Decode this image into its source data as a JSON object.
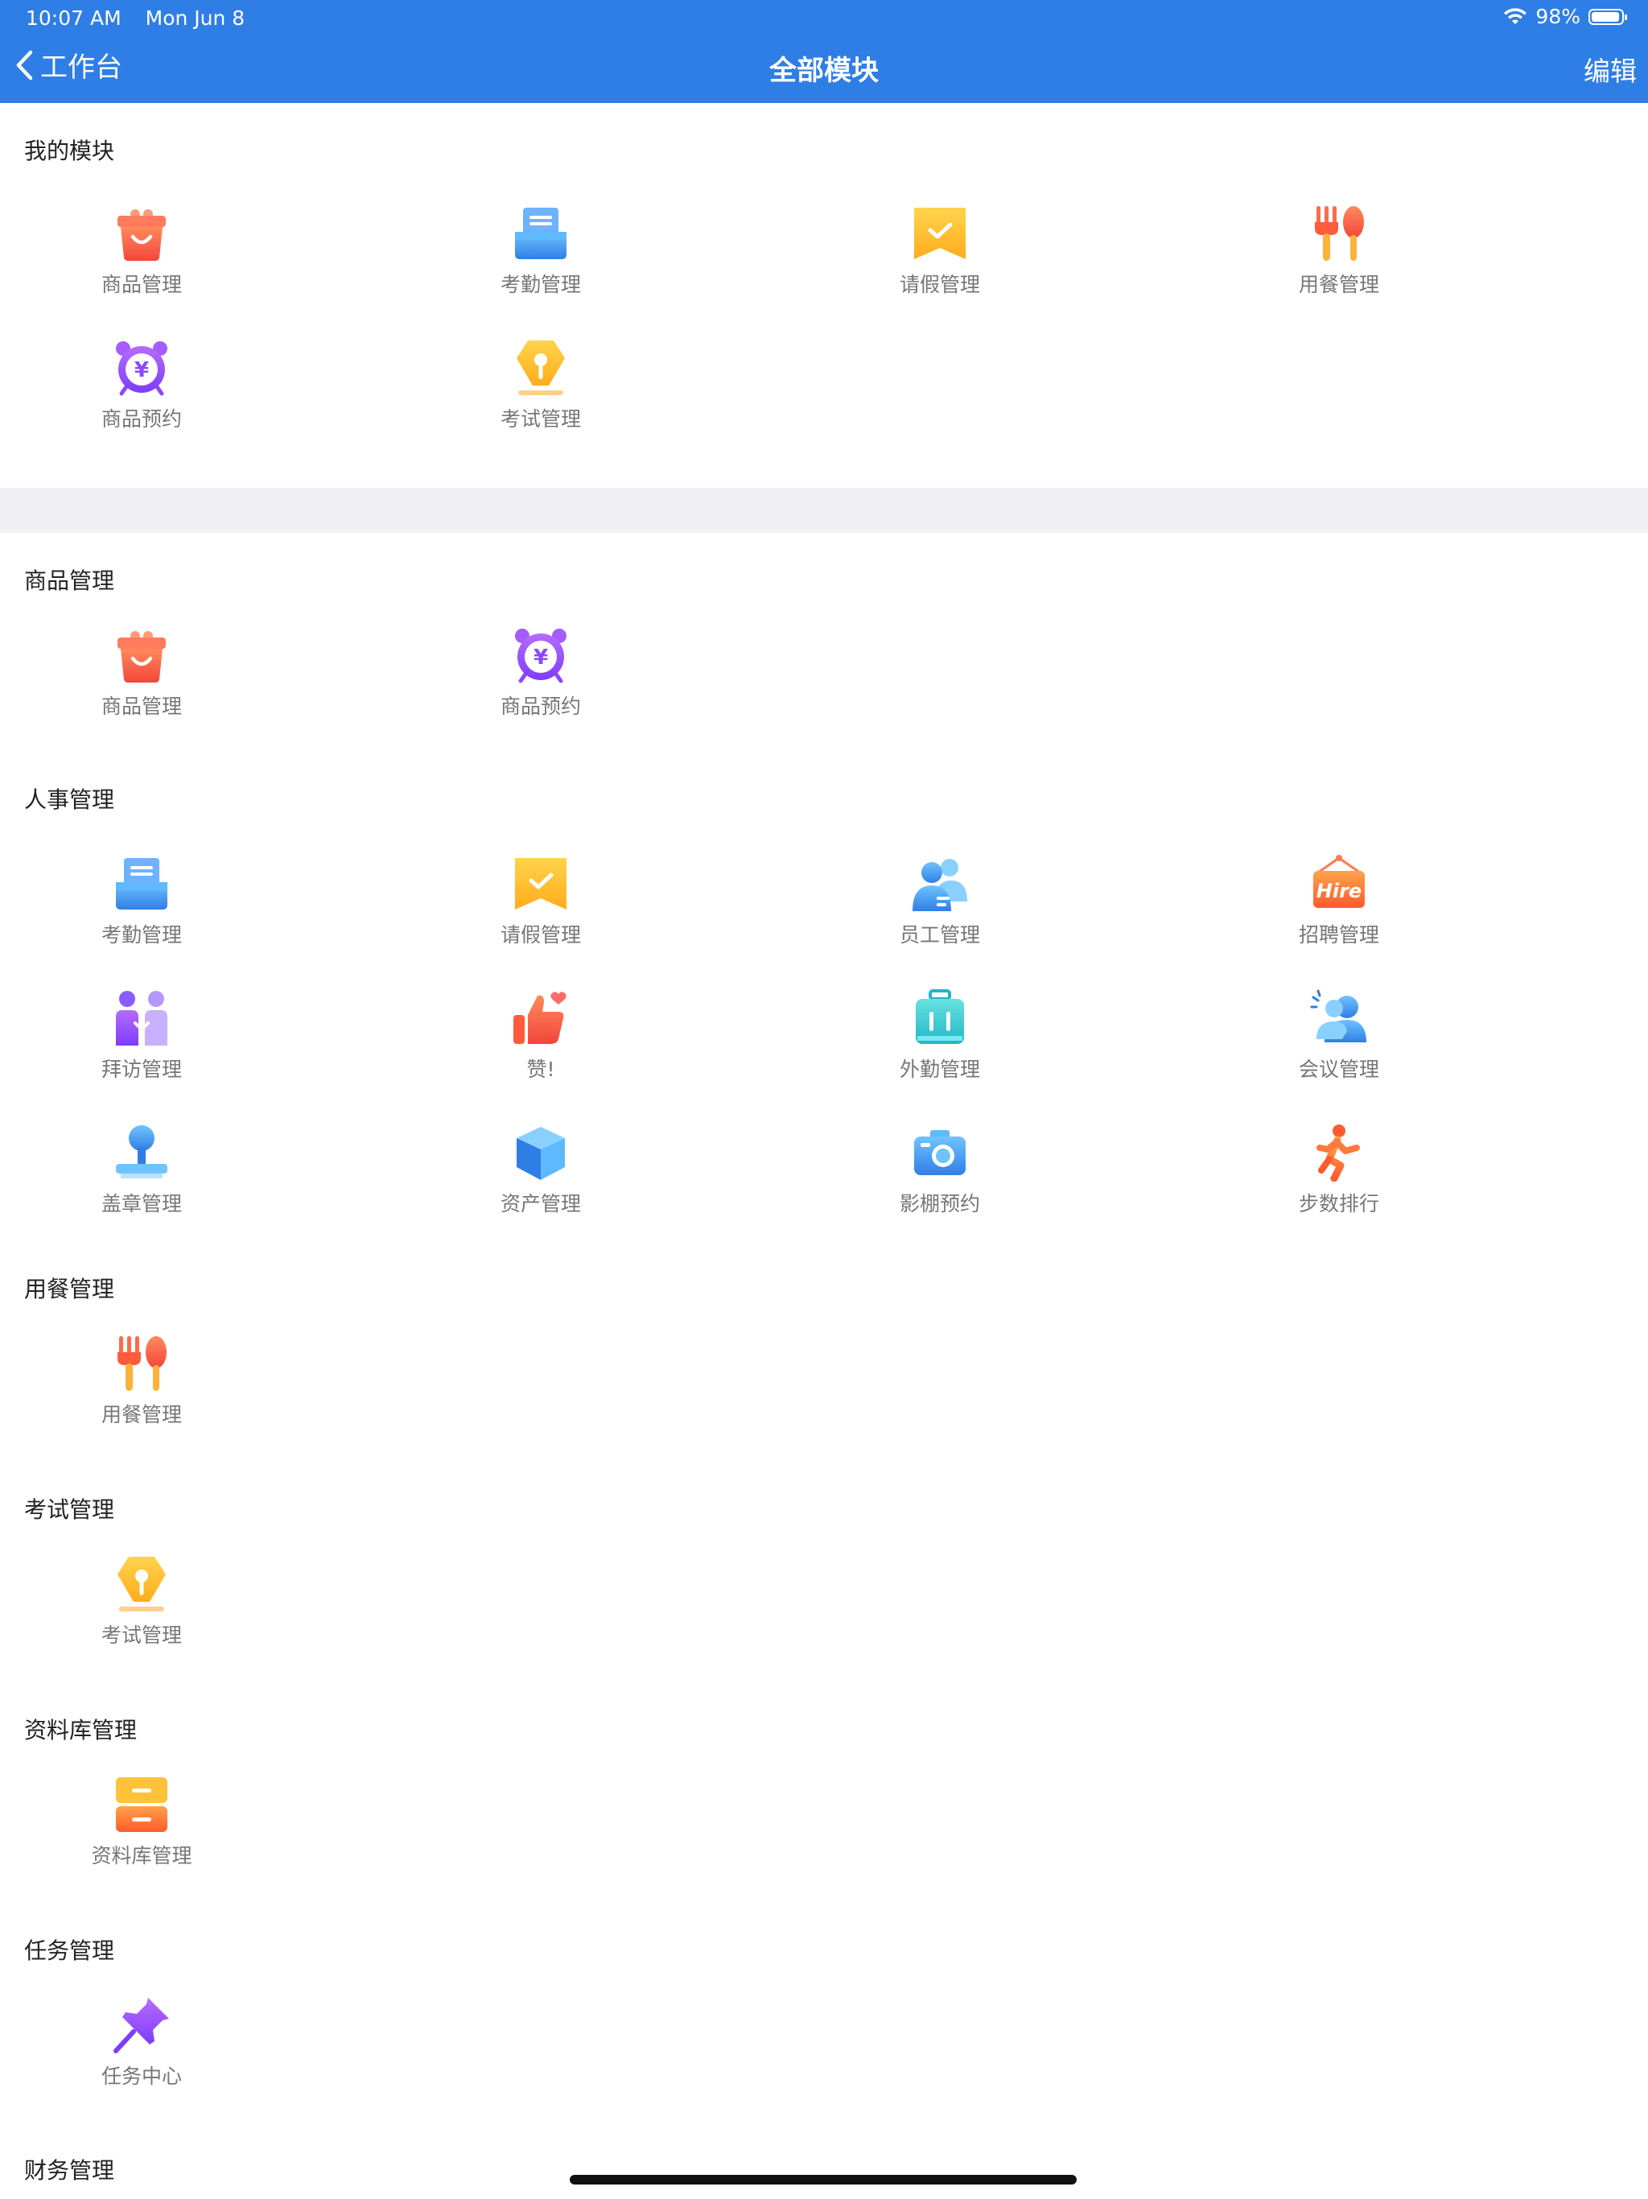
{
  "status": {
    "time": "10:07 AM",
    "date": "Mon Jun 8",
    "battery": "98%"
  },
  "nav": {
    "back_label": "工作台",
    "title": "全部模块",
    "edit_label": "编辑"
  },
  "sections": {
    "my_modules": {
      "title": "我的模块",
      "items": [
        {
          "label": "商品管理",
          "icon": "shopping-bag-icon"
        },
        {
          "label": "考勤管理",
          "icon": "attendance-box-icon"
        },
        {
          "label": "请假管理",
          "icon": "leave-ribbon-icon"
        },
        {
          "label": "用餐管理",
          "icon": "fork-spoon-icon"
        },
        {
          "label": "商品预约",
          "icon": "yen-alarm-clock-icon"
        },
        {
          "label": "考试管理",
          "icon": "exam-pen-nib-icon"
        }
      ]
    },
    "goods": {
      "title": "商品管理",
      "items": [
        {
          "label": "商品管理",
          "icon": "shopping-bag-icon"
        },
        {
          "label": "商品预约",
          "icon": "yen-alarm-clock-icon"
        }
      ]
    },
    "hr": {
      "title": "人事管理",
      "items": [
        {
          "label": "考勤管理",
          "icon": "attendance-box-icon"
        },
        {
          "label": "请假管理",
          "icon": "leave-ribbon-icon"
        },
        {
          "label": "员工管理",
          "icon": "employees-icon"
        },
        {
          "label": "招聘管理",
          "icon": "hire-sign-icon",
          "icon_text": "Hire"
        },
        {
          "label": "拜访管理",
          "icon": "visit-people-icon"
        },
        {
          "label": "赞!",
          "icon": "thumbs-up-icon"
        },
        {
          "label": "外勤管理",
          "icon": "suitcase-icon"
        },
        {
          "label": "会议管理",
          "icon": "meeting-people-icon"
        },
        {
          "label": "盖章管理",
          "icon": "stamp-icon"
        },
        {
          "label": "资产管理",
          "icon": "cube-icon"
        },
        {
          "label": "影棚预约",
          "icon": "camera-icon"
        },
        {
          "label": "步数排行",
          "icon": "running-person-icon"
        }
      ]
    },
    "dining": {
      "title": "用餐管理",
      "items": [
        {
          "label": "用餐管理",
          "icon": "fork-spoon-icon"
        }
      ]
    },
    "exam": {
      "title": "考试管理",
      "items": [
        {
          "label": "考试管理",
          "icon": "exam-pen-nib-icon"
        }
      ]
    },
    "library": {
      "title": "资料库管理",
      "items": [
        {
          "label": "资料库管理",
          "icon": "file-cabinet-icon"
        }
      ]
    },
    "tasks": {
      "title": "任务管理",
      "items": [
        {
          "label": "任务中心",
          "icon": "pushpin-icon"
        }
      ]
    },
    "finance": {
      "title": "财务管理"
    }
  },
  "colors": {
    "nav_bar": "#2f7ee6",
    "section_band": "#f0f0f4",
    "label_gray": "#777777"
  }
}
